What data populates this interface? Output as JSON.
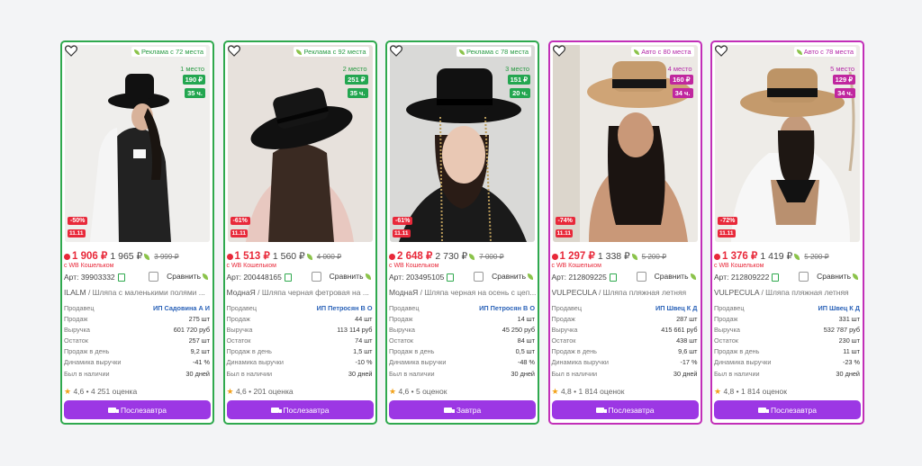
{
  "products": [
    {
      "kind": "ad",
      "promo": "Реклама с 72 места",
      "place": "1 место",
      "stat_cpm": "190 ₽",
      "stat_hours": "35 ч.",
      "discount": "-50%",
      "sale_badge": "11.11",
      "price_wallet": "1 906 ₽",
      "price": "1 965 ₽",
      "price_old": "3 999 ₽",
      "wallet_label": "с WB Кошельком",
      "article": "Арт: 39903332",
      "compare": "Сравнить",
      "brand": "ILALM",
      "name": " / Шляпа с маленькими полями ...",
      "stats": [
        {
          "k": "Продавец",
          "v": "ИП Садовина А И"
        },
        {
          "k": "Продаж",
          "v": "275 шт"
        },
        {
          "k": "Выручка",
          "v": "601 720 руб"
        },
        {
          "k": "Остаток",
          "v": "257 шт"
        },
        {
          "k": "Продаж в день",
          "v": "9,2 шт"
        },
        {
          "k": "Динамика выручки",
          "v": "-41 %"
        },
        {
          "k": "Был в наличии",
          "v": "30 дней"
        }
      ],
      "rating": "4,6",
      "reviews": "4 251 оценка",
      "delivery": "Послезавтра"
    },
    {
      "kind": "ad",
      "promo": "Реклама с 92 места",
      "place": "2 место",
      "stat_cpm": "251 ₽",
      "stat_hours": "35 ч.",
      "discount": "-61%",
      "sale_badge": "11.11",
      "price_wallet": "1 513 ₽",
      "price": "1 560 ₽",
      "price_old": "4 000 ₽",
      "wallet_label": "с WB Кошельком",
      "article": "Арт: 200448165",
      "compare": "Сравнить",
      "brand": "МоднаЯ",
      "name": " / Шляпа черная фетровая на ...",
      "stats": [
        {
          "k": "Продавец",
          "v": "ИП Петросян В О"
        },
        {
          "k": "Продаж",
          "v": "44 шт"
        },
        {
          "k": "Выручка",
          "v": "113 114 руб"
        },
        {
          "k": "Остаток",
          "v": "74 шт"
        },
        {
          "k": "Продаж в день",
          "v": "1,5 шт"
        },
        {
          "k": "Динамика выручки",
          "v": "-10 %"
        },
        {
          "k": "Был в наличии",
          "v": "30 дней"
        }
      ],
      "rating": "4,6",
      "reviews": "201 оценка",
      "delivery": "Послезавтра"
    },
    {
      "kind": "ad",
      "promo": "Реклама с 78 места",
      "place": "3 место",
      "stat_cpm": "151 ₽",
      "stat_hours": "20 ч.",
      "discount": "-61%",
      "sale_badge": "11.11",
      "price_wallet": "2 648 ₽",
      "price": "2 730 ₽",
      "price_old": "7 000 ₽",
      "wallet_label": "с WB Кошельком",
      "article": "Арт: 203495105",
      "compare": "Сравнить",
      "brand": "МоднаЯ",
      "name": " / Шляпа черная на осень с цеп...",
      "stats": [
        {
          "k": "Продавец",
          "v": "ИП Петросян В О"
        },
        {
          "k": "Продаж",
          "v": "14 шт"
        },
        {
          "k": "Выручка",
          "v": "45 250 руб"
        },
        {
          "k": "Остаток",
          "v": "84 шт"
        },
        {
          "k": "Продаж в день",
          "v": "0,5 шт"
        },
        {
          "k": "Динамика выручки",
          "v": "-48 %"
        },
        {
          "k": "Был в наличии",
          "v": "30 дней"
        }
      ],
      "rating": "4,6",
      "reviews": "5 оценок",
      "delivery": "Завтра"
    },
    {
      "kind": "auto",
      "promo": "Авто с 80 места",
      "place": "4 место",
      "stat_cpm": "160 ₽",
      "stat_hours": "34 ч.",
      "discount": "-74%",
      "sale_badge": "11.11",
      "price_wallet": "1 297 ₽",
      "price": "1 338 ₽",
      "price_old": "5 200 ₽",
      "wallet_label": "с WB Кошельком",
      "article": "Арт: 212809225",
      "compare": "Сравнить",
      "brand": "VULPECULA",
      "name": " / Шляпа пляжная летняя",
      "stats": [
        {
          "k": "Продавец",
          "v": "ИП Швец К Д"
        },
        {
          "k": "Продаж",
          "v": "287 шт"
        },
        {
          "k": "Выручка",
          "v": "415 661 руб"
        },
        {
          "k": "Остаток",
          "v": "438 шт"
        },
        {
          "k": "Продаж в день",
          "v": "9,6 шт"
        },
        {
          "k": "Динамика выручки",
          "v": "-17 %"
        },
        {
          "k": "Был в наличии",
          "v": "30 дней"
        }
      ],
      "rating": "4,8",
      "reviews": "1 814 оценок",
      "delivery": "Послезавтра"
    },
    {
      "kind": "auto",
      "promo": "Авто с 78 места",
      "place": "5 место",
      "stat_cpm": "129 ₽",
      "stat_hours": "34 ч.",
      "discount": "-72%",
      "sale_badge": "11.11",
      "price_wallet": "1 376 ₽",
      "price": "1 419 ₽",
      "price_old": "5 200 ₽",
      "wallet_label": "с WB Кошельком",
      "article": "Арт: 212809222",
      "compare": "Сравнить",
      "brand": "VULPECULA",
      "name": " / Шляпа пляжная летняя",
      "stats": [
        {
          "k": "Продавец",
          "v": "ИП Швец К Д"
        },
        {
          "k": "Продаж",
          "v": "331 шт"
        },
        {
          "k": "Выручка",
          "v": "532 787 руб"
        },
        {
          "k": "Остаток",
          "v": "230 шт"
        },
        {
          "k": "Продаж в день",
          "v": "11 шт"
        },
        {
          "k": "Динамика выручки",
          "v": "-23 %"
        },
        {
          "k": "Был в наличии",
          "v": "30 дней"
        }
      ],
      "rating": "4,8",
      "reviews": "1 814 оценок",
      "delivery": "Послезавтра"
    }
  ],
  "colors": {
    "ad_border": "#2fa94e",
    "auto_border": "#c22fb8",
    "price_red": "#e8293a",
    "button_purple": "#9c37e4",
    "seller_link": "#2a62b8"
  },
  "icons": [
    "heart-icon",
    "leaf-icon",
    "copy-icon",
    "truck-icon",
    "star-icon",
    "checkbox-icon"
  ]
}
